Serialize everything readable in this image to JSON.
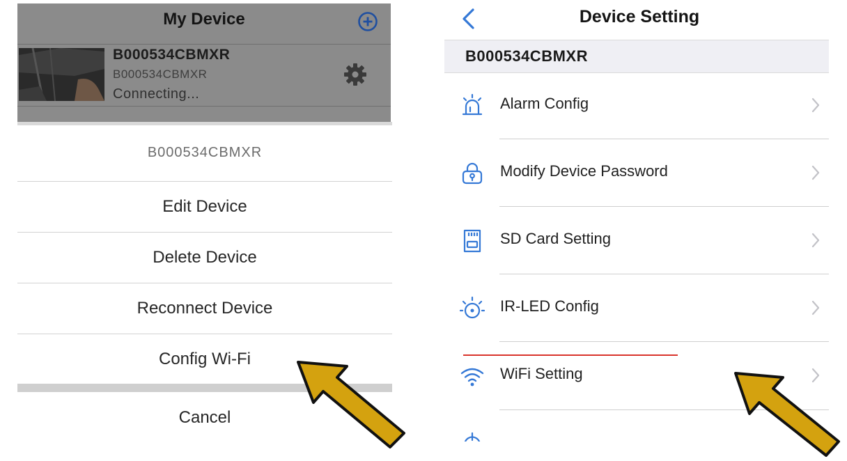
{
  "left": {
    "header": {
      "title": "My Device",
      "add_icon": "plus-circle-icon"
    },
    "device": {
      "name": "B000534CBMXR",
      "uid": "B000534CBMXR",
      "status": "Connecting...",
      "settings_icon": "gear-icon"
    },
    "action_sheet": {
      "title": "B000534CBMXR",
      "items": [
        "Edit Device",
        "Delete Device",
        "Reconnect Device",
        "Config Wi-Fi"
      ],
      "cancel": "Cancel"
    }
  },
  "right": {
    "header": {
      "title": "Device Setting",
      "back_icon": "chevron-left-icon"
    },
    "section_label": "B000534CBMXR",
    "items": [
      {
        "label": "Alarm Config",
        "icon": "alarm-siren-icon"
      },
      {
        "label": "Modify Device Password",
        "icon": "lock-icon"
      },
      {
        "label": "SD Card Setting",
        "icon": "sd-card-icon"
      },
      {
        "label": "IR-LED Config",
        "icon": "ir-led-icon"
      },
      {
        "label": "WiFi Setting",
        "icon": "wifi-icon"
      }
    ]
  },
  "colors": {
    "accent_blue": "#3478d6",
    "pointer_arrow": "#d4a20f",
    "highlight_red": "#d9342b",
    "dim_overlay": "#8b8b8b"
  }
}
